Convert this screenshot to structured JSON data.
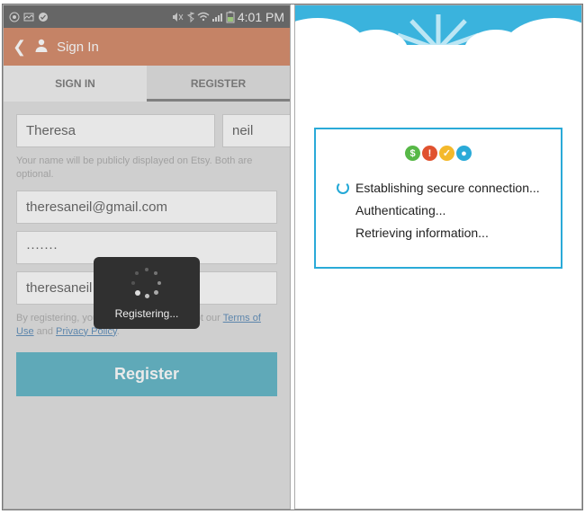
{
  "left": {
    "statusbar": {
      "time": "4:01 PM"
    },
    "appbar": {
      "title": "Sign In"
    },
    "tabs": {
      "signin": "SIGN IN",
      "register": "REGISTER"
    },
    "form": {
      "first_name": "Theresa",
      "last_name": "neil",
      "name_help": "Your name will be publicly displayed on Etsy. Both are optional.",
      "email": "theresaneil@gmail.com",
      "password": "·······",
      "username": "theresaneil",
      "disclaimer_prefix": "By registering, you confirm that you accept our ",
      "terms_link": "Terms of Use",
      "disclaimer_and": " and ",
      "privacy_link": "Privacy Policy",
      "disclaimer_suffix": ".",
      "register_btn": "Register"
    },
    "toast": {
      "label": "Registering..."
    }
  },
  "right": {
    "steps": {
      "s1": "Establishing secure connection...",
      "s2": "Authenticating...",
      "s3": "Retrieving information..."
    }
  }
}
